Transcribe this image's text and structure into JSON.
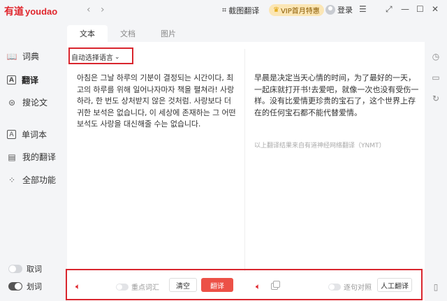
{
  "app": {
    "logo_cn": "有道",
    "logo_en": "youdao",
    "back_icon": "‹",
    "forward_icon": "›",
    "screenshot_label": "截图翻译",
    "vip_label": "VIP首月特惠",
    "login_label": "登录",
    "accent": "#e0262d"
  },
  "sidebar": {
    "items": [
      {
        "label": "词典",
        "icon": "dictionary-icon"
      },
      {
        "label": "翻译",
        "icon": "translate-icon"
      },
      {
        "label": "搜论文",
        "icon": "search-paper-icon"
      },
      {
        "label": "单词本",
        "icon": "wordbook-icon"
      },
      {
        "label": "我的翻译",
        "icon": "my-translation-icon"
      },
      {
        "label": "全部功能",
        "icon": "all-features-icon"
      }
    ],
    "toggles": [
      {
        "label": "取词",
        "on": false
      },
      {
        "label": "划词",
        "on": true
      }
    ]
  },
  "tabs": [
    "文本",
    "文档",
    "图片"
  ],
  "main": {
    "language_select": "自动选择语言",
    "source_text": "아침은 그날 하루의 기분이 결정되는 시간이다, 최고의 하루를 위해 일어나자마자 책을 펼쳐라! 사랑하라, 한 번도 상처받지 않은 것처럼. 사랑보다 더 귀한 보석은 없습니다, 이 세상에 존재하는 그 어떤 보석도 사랑을 대신해줄 수는 없습니다.",
    "target_text": "早晨是决定当天心情的时间，为了最好的一天，一起床就打开书!去爱吧，就像一次也没有受伤一样。没有比爱情更珍贵的宝石了，这个世界上存在的任何宝石都不能代替爱情。",
    "note": "以上翻译结果来自有道神经网络翻译（YNMT）",
    "key_words_label": "重点词汇",
    "clear_label": "清空",
    "translate_label": "翻译",
    "sentence_compare_label": "逐句对照",
    "human_translate_label": "人工翻译"
  }
}
